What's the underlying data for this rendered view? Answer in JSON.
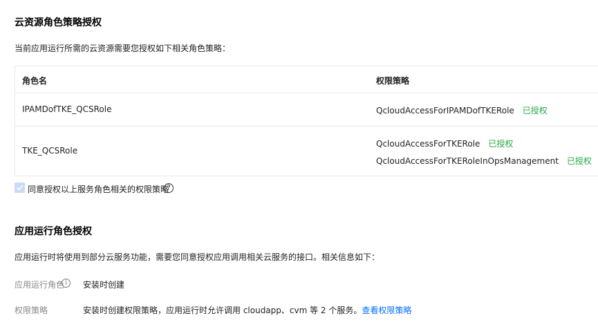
{
  "section1": {
    "title": "云资源角色策略授权",
    "desc": "当前应用运行所需的云资源需要您授权如下相关角色策略：",
    "table": {
      "headers": [
        "角色名",
        "权限策略"
      ],
      "rows": [
        {
          "role": "IPAMDofTKE_QCSRole",
          "policies": [
            {
              "name": "QcloudAccessForIPAMDofTKERole",
              "status": "已授权"
            }
          ]
        },
        {
          "role": "TKE_QCSRole",
          "policies": [
            {
              "name": "QcloudAccessForTKERole",
              "status": "已授权"
            },
            {
              "name": "QcloudAccessForTKERoleInOpsManagement",
              "status": "已授权"
            }
          ]
        }
      ]
    },
    "agree": {
      "label": "同意授权以上服务角色相关的权限策略",
      "checked": true,
      "help_icon": "?"
    }
  },
  "section2": {
    "title": "应用运行角色授权",
    "desc": "应用运行时将使用到部分云服务功能，需要您同意授权应用调用相关云服务的接口。相关信息如下：",
    "fields": [
      {
        "label": "应用运行角色",
        "info_icon": "i",
        "value": "安装时创建"
      },
      {
        "label": "权限策略",
        "value": "安装时创建权限策略，应用运行时允许调用 cloudapp、cvm 等 2 个服务。",
        "link": "查看权限策略"
      }
    ]
  },
  "colors": {
    "authorized": "#29a745",
    "link": "#006eff"
  }
}
